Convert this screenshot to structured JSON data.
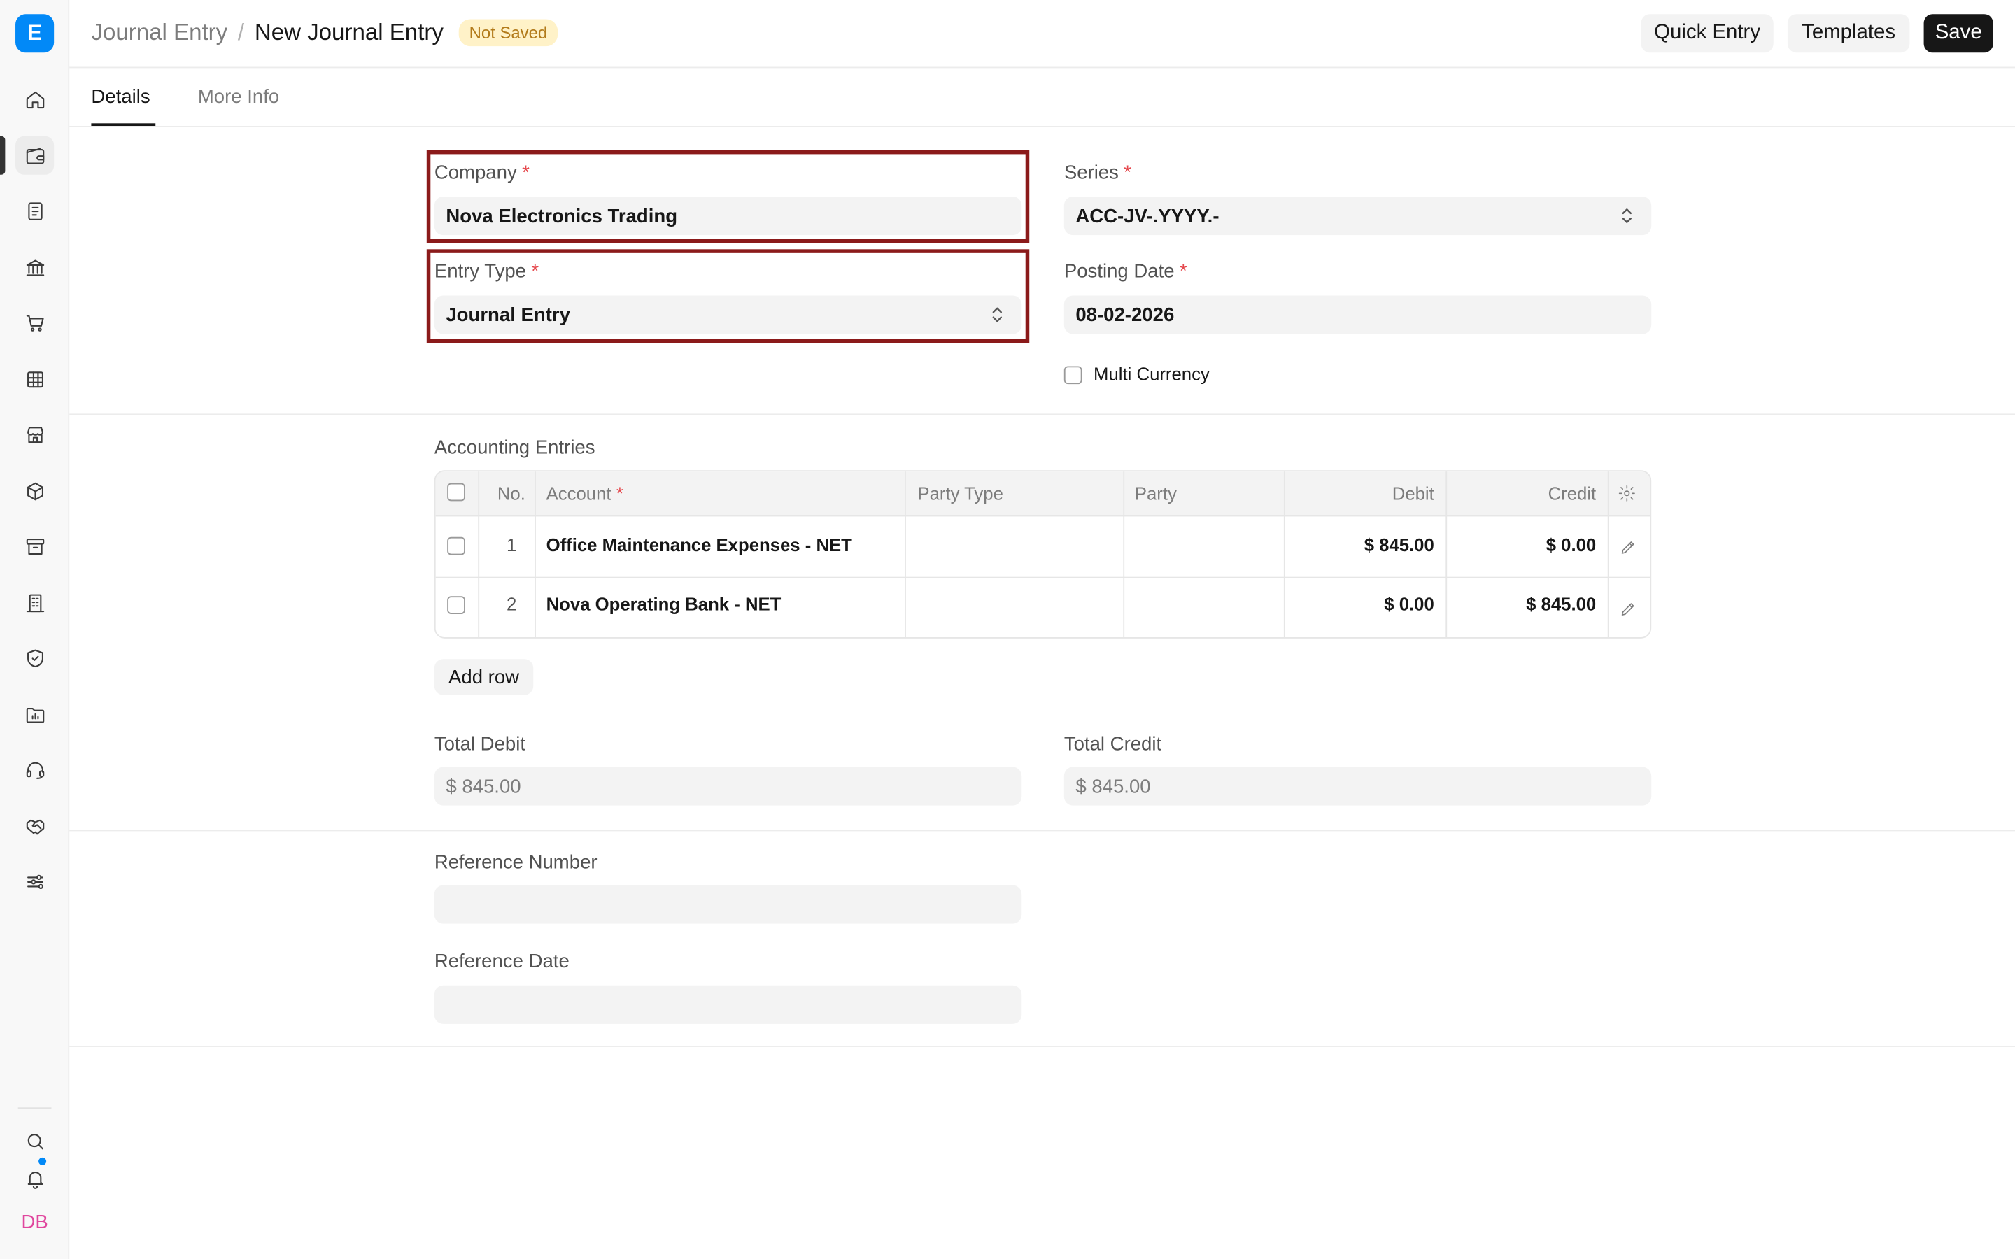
{
  "app": {
    "logo_letter": "E"
  },
  "sidebar": {
    "items": [
      "home-icon",
      "wallet-icon",
      "document-icon",
      "bank-icon",
      "cart-icon",
      "table-icon",
      "store-icon",
      "box-icon",
      "archive-icon",
      "building-icon",
      "shield-icon",
      "folder-chart-icon",
      "headset-icon",
      "handshake-icon",
      "sliders-icon"
    ],
    "bottom": [
      "search-icon",
      "bell-icon"
    ],
    "avatar_initials": "DB",
    "accent_color": "#0289f7"
  },
  "header": {
    "breadcrumb_parent": "Journal Entry",
    "breadcrumb_separator": "/",
    "title": "New Journal Entry",
    "status_badge": "Not Saved",
    "buttons": {
      "quick_entry": "Quick Entry",
      "templates": "Templates",
      "save": "Save"
    }
  },
  "tabs": {
    "details": "Details",
    "more_info": "More Info"
  },
  "form": {
    "company": {
      "label": "Company",
      "required": "*",
      "value": "Nova Electronics Trading"
    },
    "series": {
      "label": "Series",
      "required": "*",
      "value": "ACC-JV-.YYYY.-"
    },
    "entry_type": {
      "label": "Entry Type",
      "required": "*",
      "value": "Journal Entry"
    },
    "posting_date": {
      "label": "Posting Date",
      "required": "*",
      "value": "08-02-2026"
    },
    "multi_currency": {
      "label": "Multi Currency",
      "checked": false
    }
  },
  "accounting": {
    "section_label": "Accounting Entries",
    "columns": {
      "no": "No.",
      "account": "Account",
      "account_required": "*",
      "party_type": "Party Type",
      "party": "Party",
      "debit": "Debit",
      "credit": "Credit"
    },
    "rows": [
      {
        "no": "1",
        "account": "Office Maintenance Expenses - NET",
        "party_type": "",
        "party": "",
        "debit": "$ 845.00",
        "credit": "$ 0.00"
      },
      {
        "no": "2",
        "account": "Nova Operating Bank - NET",
        "party_type": "",
        "party": "",
        "debit": "$ 0.00",
        "credit": "$ 845.00"
      }
    ],
    "add_row": "Add row"
  },
  "totals": {
    "total_debit": {
      "label": "Total Debit",
      "value": "$ 845.00"
    },
    "total_credit": {
      "label": "Total Credit",
      "value": "$ 845.00"
    }
  },
  "reference": {
    "number": {
      "label": "Reference Number",
      "value": ""
    },
    "date": {
      "label": "Reference Date",
      "value": ""
    }
  }
}
